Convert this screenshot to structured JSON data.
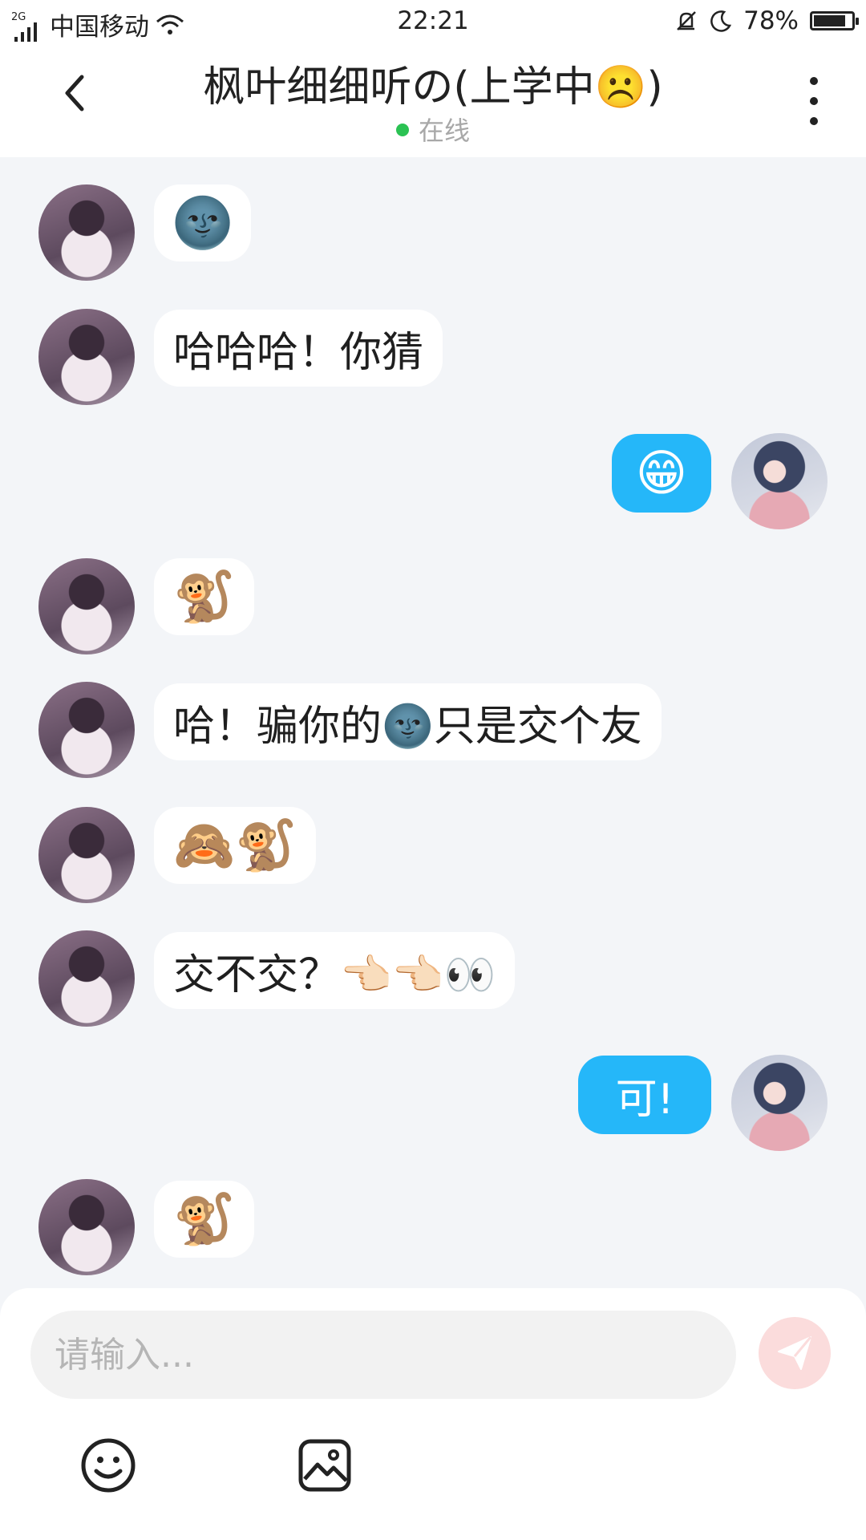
{
  "status_bar": {
    "network_tag": "2G",
    "carrier": "中国移动",
    "time": "22:21",
    "battery": "78%",
    "battery_level": 0.78
  },
  "header": {
    "title": "枫叶细细听の(上学中☹️)",
    "status": "在线",
    "status_color": "#2bc253"
  },
  "messages": [
    {
      "side": "left",
      "text": "🌚"
    },
    {
      "side": "left",
      "text": "哈哈哈！你猜"
    },
    {
      "side": "right",
      "text": "😁"
    },
    {
      "side": "left",
      "text": "🐒"
    },
    {
      "side": "left",
      "text": "哈！骗你的🌚只是交个友"
    },
    {
      "side": "left",
      "text": "🙈🐒"
    },
    {
      "side": "left",
      "text": "交不交？👈🏻👈🏻👀"
    },
    {
      "side": "right",
      "text": "可!"
    },
    {
      "side": "left",
      "text": "🐒"
    }
  ],
  "composer": {
    "placeholder": "请输入...",
    "accent_color": "#25b7f9"
  },
  "icons": [
    "back-icon",
    "more-icon",
    "send-icon",
    "emoji-icon",
    "image-icon"
  ]
}
